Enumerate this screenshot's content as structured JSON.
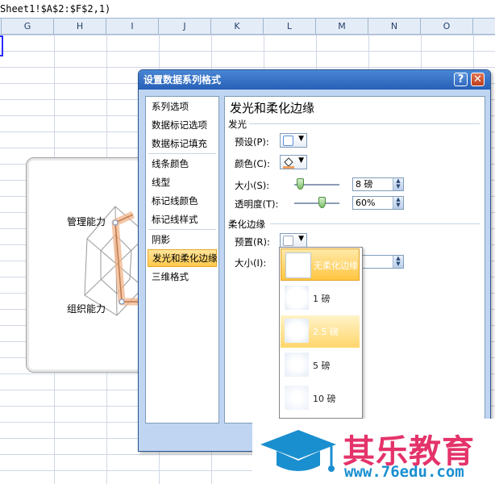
{
  "formula_bar": {
    "text": "Sheet1!$A$2:$F$2,1)"
  },
  "columns": [
    "G",
    "H",
    "I",
    "J",
    "K",
    "L",
    "M",
    "N",
    "O"
  ],
  "chart": {
    "axis_labels": [
      "管理能力",
      "组织能力"
    ]
  },
  "dialog": {
    "title": "设置数据系列格式",
    "help_glyph": "?",
    "close_glyph": "✕",
    "nav": {
      "group1": [
        "系列选项",
        "数据标记选项",
        "数据标记填充"
      ],
      "group2": [
        "线条颜色",
        "线型",
        "标记线颜色",
        "标记线样式"
      ],
      "group3": [
        "阴影",
        "发光和柔化边缘",
        "三维格式"
      ],
      "selected": "发光和柔化边缘"
    },
    "content": {
      "heading": "发光和柔化边缘",
      "glow": {
        "section": "发光",
        "preset_label": "预设(P):",
        "color_label": "颜色(C):",
        "size_label": "大小(S):",
        "size_value": "8 磅",
        "transparency_label": "透明度(T):",
        "transparency_value": "60%",
        "size_slider": 0.12,
        "transparency_slider": 0.6
      },
      "soft_edges": {
        "section": "柔化边缘",
        "preset_label": "预置(R):",
        "size_label": "大小(I):",
        "options": [
          "无柔化边缘",
          "1 磅",
          "2.5 磅",
          "5 磅",
          "10 磅"
        ],
        "selected": "无柔化边缘",
        "hovered": "2.5 磅"
      }
    }
  },
  "watermark": {
    "brand": "其乐教育",
    "url": "www.76edu.com"
  },
  "colors": {
    "accent_blue": "#2660b8",
    "nav_selected": "#ffc94a",
    "brand_pink": "#e4336a",
    "brand_blue": "#1a8fd0"
  },
  "icons": [
    "help-icon",
    "close-icon",
    "chevron-down-icon",
    "fill-bucket-icon",
    "graduation-cap-icon"
  ]
}
